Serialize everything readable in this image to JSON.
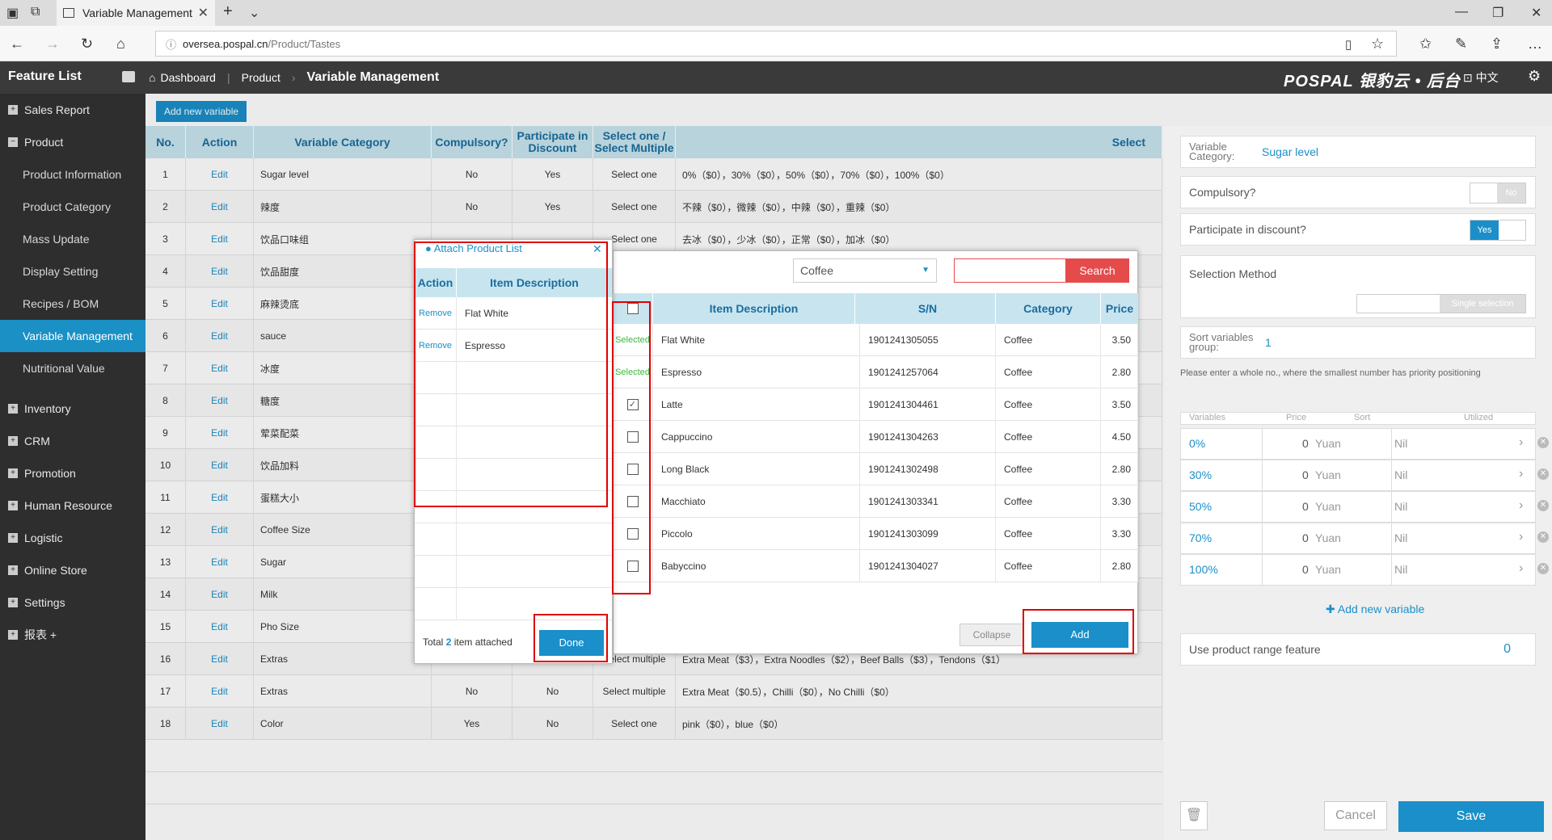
{
  "browser": {
    "tab_title": "Variable Management",
    "url_host": "oversea.pospal.cn",
    "url_path": "/Product/Tastes"
  },
  "header": {
    "feature_list": "Feature List",
    "crumbs": [
      "Dashboard",
      "Product",
      "Variable Management"
    ],
    "logo": "POSPAL 银豹云 • 后台",
    "lang": "中文"
  },
  "sidebar": {
    "groups": [
      "Sales Report",
      "Product"
    ],
    "product_items": [
      "Product Information",
      "Product Category",
      "Mass Update",
      "Display Setting",
      "Recipes / BOM",
      "Variable Management",
      "Nutritional Value"
    ],
    "after": [
      "Inventory",
      "CRM",
      "Promotion",
      "Human Resource",
      "Logistic",
      "Online Store",
      "Settings",
      "报表 +"
    ]
  },
  "main": {
    "add_button": "Add new variable",
    "columns": [
      "No.",
      "Action",
      "Variable Category",
      "Compulsory?",
      "Participate in Discount",
      "Select one / Select Multiple",
      "Select"
    ],
    "rows": [
      [
        "1",
        "Edit",
        "Sugar level",
        "No",
        "Yes",
        "Select one",
        "0%（$0），30%（$0），50%（$0），70%（$0），100%（$0）"
      ],
      [
        "2",
        "Edit",
        "辣度",
        "No",
        "Yes",
        "Select one",
        "不辣（$0），微辣（$0），中辣（$0），重辣（$0）"
      ],
      [
        "3",
        "Edit",
        "饮品口味组",
        "",
        "",
        "Select one",
        "去冰（$0），少冰（$0），正常（$0），加冰（$0）"
      ],
      [
        "4",
        "Edit",
        "饮品甜度",
        "",
        "",
        "",
        ""
      ],
      [
        "5",
        "Edit",
        "麻辣烫底",
        "",
        "",
        "",
        ""
      ],
      [
        "6",
        "Edit",
        "sauce",
        "",
        "",
        "",
        ""
      ],
      [
        "7",
        "Edit",
        "冰度",
        "",
        "",
        "",
        ""
      ],
      [
        "8",
        "Edit",
        "糖度",
        "",
        "",
        "",
        ""
      ],
      [
        "9",
        "Edit",
        "荤菜配菜",
        "",
        "",
        "",
        ""
      ],
      [
        "10",
        "Edit",
        "饮品加料",
        "",
        "",
        "",
        ""
      ],
      [
        "11",
        "Edit",
        "蛋糕大小",
        "",
        "",
        "",
        ""
      ],
      [
        "12",
        "Edit",
        "Coffee Size",
        "",
        "",
        "",
        ""
      ],
      [
        "13",
        "Edit",
        "Sugar",
        "",
        "",
        "",
        ""
      ],
      [
        "14",
        "Edit",
        "Milk",
        "",
        "",
        "",
        ""
      ],
      [
        "15",
        "Edit",
        "Pho Size",
        "",
        "",
        "",
        ""
      ],
      [
        "16",
        "Edit",
        "Extras",
        "",
        "",
        "Select multiple",
        "Extra Meat（$3），Extra Noodles（$2），Beef Balls（$3），Tendons（$1）"
      ],
      [
        "17",
        "Edit",
        "Extras",
        "No",
        "No",
        "Select multiple",
        "Extra Meat（$0.5），Chilli（$0），No Chilli（$0）"
      ],
      [
        "18",
        "Edit",
        "Color",
        "Yes",
        "No",
        "Select one",
        "pink（$0），blue（$0）"
      ]
    ]
  },
  "right_panel": {
    "variable_category_label": "Variable Category:",
    "variable_category_value": "Sugar level",
    "compulsory_label": "Compulsory?",
    "compulsory_value": "No",
    "discount_label": "Participate in discount?",
    "discount_value": "Yes",
    "selection_method_label": "Selection Method",
    "selection_method_value": "Single selection",
    "sort_label": "Sort variables group:",
    "sort_value": "1",
    "sort_hint": "Please enter a whole no., where the smallest number has priority positioning",
    "var_columns": [
      "Variables",
      "Price",
      "Sort",
      "Utilized"
    ],
    "variables": [
      {
        "name": "0%",
        "price": "0",
        "unit": "Yuan",
        "utilized": "Nil"
      },
      {
        "name": "30%",
        "price": "0",
        "unit": "Yuan",
        "utilized": "Nil"
      },
      {
        "name": "50%",
        "price": "0",
        "unit": "Yuan",
        "utilized": "Nil"
      },
      {
        "name": "70%",
        "price": "0",
        "unit": "Yuan",
        "utilized": "Nil"
      },
      {
        "name": "100%",
        "price": "0",
        "unit": "Yuan",
        "utilized": "Nil"
      }
    ],
    "add_variable": "Add new variable",
    "product_range_label": "Use product range feature",
    "product_range_value": "0",
    "cancel": "Cancel",
    "save": "Save"
  },
  "product_modal": {
    "category": "Coffee",
    "search_button": "Search",
    "columns": [
      "Item Description",
      "S/N",
      "Category",
      "Price"
    ],
    "rows": [
      {
        "status": "Selected",
        "desc": "Flat White",
        "sn": "1901241305055",
        "cat": "Coffee",
        "price": "3.50"
      },
      {
        "status": "Selected",
        "desc": "Espresso",
        "sn": "1901241257064",
        "cat": "Coffee",
        "price": "2.80"
      },
      {
        "status": "checked",
        "desc": "Latte",
        "sn": "1901241304461",
        "cat": "Coffee",
        "price": "3.50"
      },
      {
        "status": "",
        "desc": "Cappuccino",
        "sn": "1901241304263",
        "cat": "Coffee",
        "price": "4.50"
      },
      {
        "status": "",
        "desc": "Long Black",
        "sn": "1901241302498",
        "cat": "Coffee",
        "price": "2.80"
      },
      {
        "status": "",
        "desc": "Macchiato",
        "sn": "1901241303341",
        "cat": "Coffee",
        "price": "3.30"
      },
      {
        "status": "",
        "desc": "Piccolo",
        "sn": "1901241303099",
        "cat": "Coffee",
        "price": "3.30"
      },
      {
        "status": "",
        "desc": "Babyccino",
        "sn": "1901241304027",
        "cat": "Coffee",
        "price": "2.80"
      }
    ],
    "collapse": "Collapse",
    "add": "Add"
  },
  "attach_modal": {
    "title": "Attach Product List",
    "columns": [
      "Action",
      "Item Description"
    ],
    "rows": [
      {
        "action": "Remove",
        "desc": "Flat White"
      },
      {
        "action": "Remove",
        "desc": "Espresso"
      }
    ],
    "total_prefix": "Total",
    "total_count": "2",
    "total_suffix": "item attached",
    "done": "Done"
  },
  "colors": {
    "accent": "#1a8fc9",
    "header_bg": "#c8e5ef",
    "danger": "#e64b4b",
    "highlight_box": "#e00000"
  }
}
